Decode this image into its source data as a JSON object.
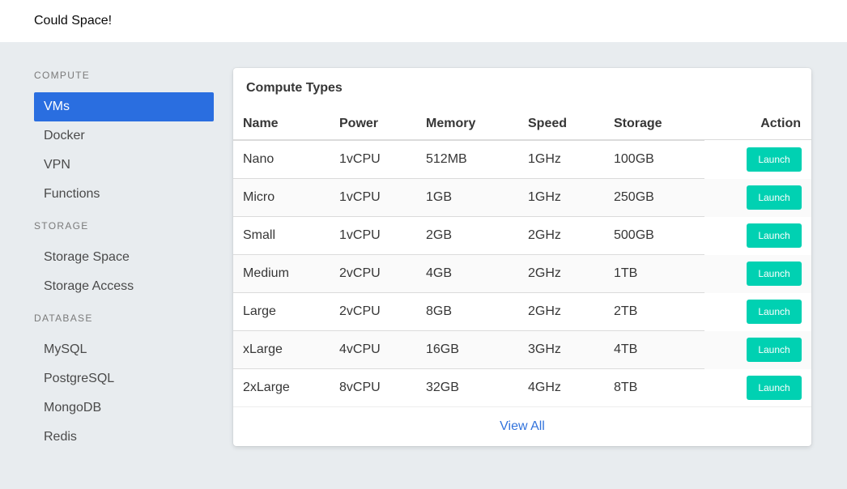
{
  "navbar": {
    "brand": "Could Space!"
  },
  "sidebar": {
    "compute_label": "COMPUTE",
    "compute_items": [
      "VMs",
      "Docker",
      "VPN",
      "Functions"
    ],
    "storage_label": "STORAGE",
    "storage_items": [
      "Storage Space",
      "Storage Access"
    ],
    "database_label": "DATABASE",
    "database_items": [
      "MySQL",
      "PostgreSQL",
      "MongoDB",
      "Redis"
    ],
    "active_item": "VMs"
  },
  "card": {
    "title": "Compute Types",
    "columns": [
      "Name",
      "Power",
      "Memory",
      "Speed",
      "Storage",
      "Action"
    ],
    "rows": [
      [
        "Nano",
        "1vCPU",
        "512MB",
        "1GHz",
        "100GB"
      ],
      [
        "Micro",
        "1vCPU",
        "1GB",
        "1GHz",
        "250GB"
      ],
      [
        "Small",
        "1vCPU",
        "2GB",
        "2GHz",
        "500GB"
      ],
      [
        "Medium",
        "2vCPU",
        "4GB",
        "2GHz",
        "1TB"
      ],
      [
        "Large",
        "2vCPU",
        "8GB",
        "2GHz",
        "2TB"
      ],
      [
        "xLarge",
        "4vCPU",
        "16GB",
        "3GHz",
        "4TB"
      ],
      [
        "2xLarge",
        "8vCPU",
        "32GB",
        "4GHz",
        "8TB"
      ]
    ],
    "launch_label": "Launch",
    "view_all": "View All"
  },
  "colors": {
    "accent": "#2a6ee0",
    "launch": "#00d1b2",
    "link": "#3273dc",
    "background": "#e8ecef"
  }
}
